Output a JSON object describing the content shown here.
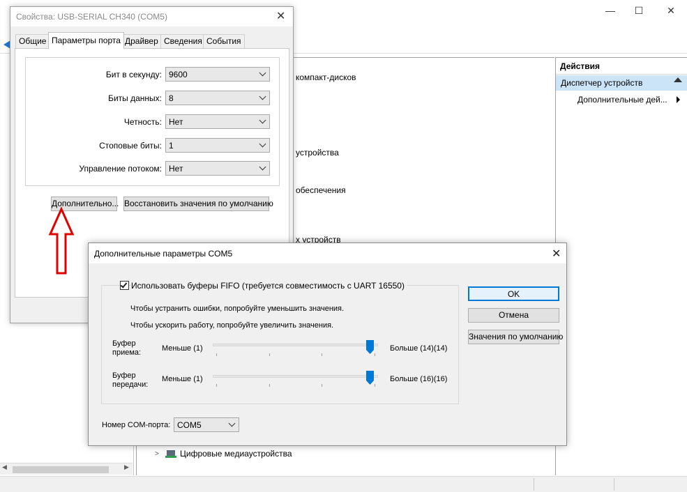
{
  "background_window": {
    "caption_buttons": {
      "minimize": "—",
      "maximize": "☐",
      "close": "✕"
    },
    "tree_items": [
      {
        "text": "компакт-дисков"
      },
      {
        "text": "устройства"
      },
      {
        "text": "обеспечения"
      },
      {
        "text": "х устройств"
      },
      {
        "text": "Цифровые медиаустройства"
      }
    ],
    "actions": {
      "header": "Действия",
      "selected": "Диспетчер устройств",
      "item": "Дополнительные дей..."
    }
  },
  "properties_dialog": {
    "title": "Свойства: USB-SERIAL CH340 (COM5)",
    "tabs": [
      "Общие",
      "Параметры порта",
      "Драйвер",
      "Сведения",
      "События"
    ],
    "active_tab": "Параметры порта",
    "fields": [
      {
        "label": "Бит в секунду:",
        "value": "9600"
      },
      {
        "label": "Биты данных:",
        "value": "8"
      },
      {
        "label": "Четность:",
        "value": "Нет"
      },
      {
        "label": "Стоповые биты:",
        "value": "1"
      },
      {
        "label": "Управление потоком:",
        "value": "Нет"
      }
    ],
    "buttons": {
      "advanced": "Дополнительно...",
      "restore": "Восстановить значения по умолчанию"
    }
  },
  "advanced_dialog": {
    "title": "Дополнительные параметры COM5",
    "fifo_label": "Использовать буферы FIFO (требуется совместимость с UART 16550)",
    "fifo_checked": true,
    "hint1": "Чтобы устранить ошибки, попробуйте уменьшить значения.",
    "hint2": "Чтобы ускорить работу, попробуйте увеличить значения.",
    "receive": {
      "label_line1": "Буфер",
      "label_line2": "приема:",
      "min": "Меньше (1)",
      "max": "Больше (14)",
      "current": "(14)",
      "level": 1.0
    },
    "transmit": {
      "label_line1": "Буфер",
      "label_line2": "передачи:",
      "min": "Меньше (1)",
      "max": "Больше (16)",
      "current": "(16)",
      "level": 1.0
    },
    "buttons": {
      "ok": "OK",
      "cancel": "Отмена",
      "defaults": "Значения по умолчанию"
    },
    "com_port_label": "Номер COM-порта:",
    "com_port_value": "COM5"
  },
  "colors": {
    "accent": "#0078d7",
    "selection": "#cce4f7",
    "annotation_arrow": "#e00000"
  }
}
